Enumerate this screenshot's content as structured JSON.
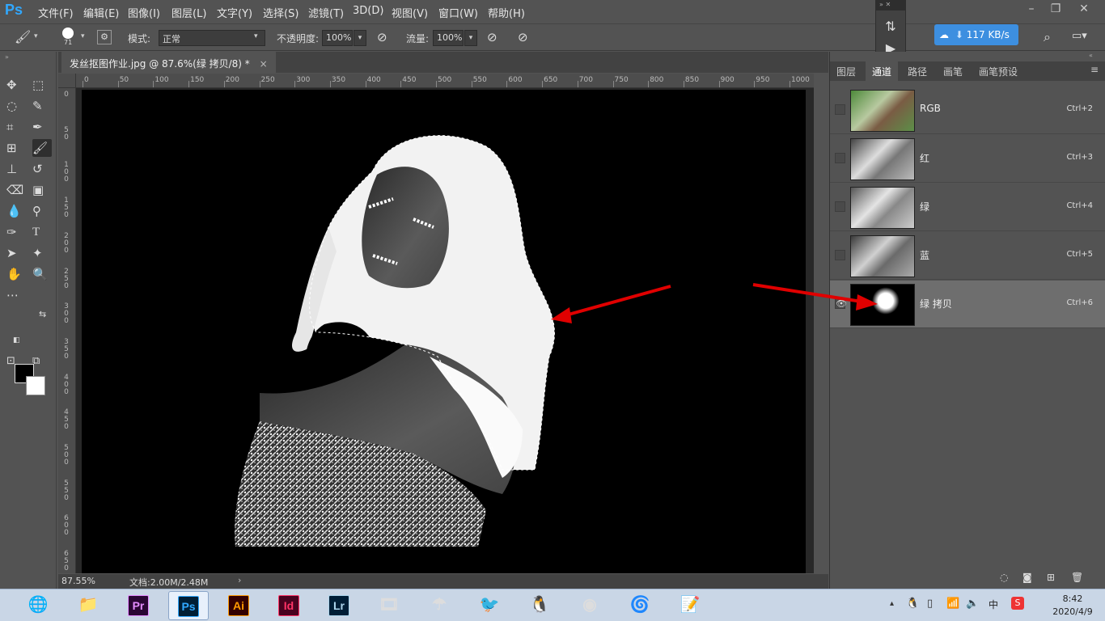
{
  "app": {
    "logo": "Ps"
  },
  "menu": [
    {
      "label": "文件(F)"
    },
    {
      "label": "编辑(E)"
    },
    {
      "label": "图像(I)"
    },
    {
      "label": "图层(L)"
    },
    {
      "label": "文字(Y)"
    },
    {
      "label": "选择(S)"
    },
    {
      "label": "滤镜(T)"
    },
    {
      "label": "3D(D)"
    },
    {
      "label": "视图(V)"
    },
    {
      "label": "窗口(W)"
    },
    {
      "label": "帮助(H)"
    }
  ],
  "options": {
    "brush_size": "71",
    "mode_label": "模式:",
    "mode_value": "正常",
    "opacity_label": "不透明度:",
    "opacity_value": "100%",
    "flow_label": "流量:",
    "flow_value": "100%"
  },
  "netspeed": {
    "text": "117 KB/s"
  },
  "document": {
    "tab_title": "发丝抠图作业.jpg @ 87.6%(绿 拷贝/8) *",
    "close": "×",
    "zoom": "87.55%",
    "doc_info": "文档:2.00M/2.48M"
  },
  "ruler": {
    "h_ticks": [
      "0",
      "50",
      "100",
      "150",
      "200",
      "250",
      "300",
      "350",
      "400",
      "450",
      "500",
      "550",
      "600",
      "650",
      "700",
      "750",
      "800",
      "850",
      "900",
      "950",
      "1000"
    ],
    "v_ticks": [
      "0",
      "50",
      "100",
      "150",
      "200",
      "250",
      "300",
      "350",
      "400",
      "450",
      "500",
      "550",
      "600",
      "650"
    ]
  },
  "panel": {
    "tabs": [
      {
        "label": "图层"
      },
      {
        "label": "通道"
      },
      {
        "label": "路径"
      },
      {
        "label": "画笔"
      },
      {
        "label": "画笔预设"
      }
    ],
    "active_tab": "通道",
    "channels": [
      {
        "name": "RGB",
        "shortcut": "Ctrl+2",
        "visible": false
      },
      {
        "name": "红",
        "shortcut": "Ctrl+3",
        "visible": false
      },
      {
        "name": "绿",
        "shortcut": "Ctrl+4",
        "visible": false
      },
      {
        "name": "蓝",
        "shortcut": "Ctrl+5",
        "visible": false
      },
      {
        "name": "绿 拷贝",
        "shortcut": "Ctrl+6",
        "visible": true,
        "selected": true
      }
    ]
  },
  "taskbar": {
    "apps": [
      {
        "icon": "browser-icon"
      },
      {
        "icon": "file-explorer-icon"
      },
      {
        "icon": "premiere-icon",
        "label": "Pr",
        "color": "#e48cff",
        "bg": "#2a0634"
      },
      {
        "icon": "photoshop-icon",
        "label": "Ps",
        "color": "#31a8ff",
        "bg": "#001e36"
      },
      {
        "icon": "illustrator-icon",
        "label": "Ai",
        "color": "#ff9a00",
        "bg": "#330000"
      },
      {
        "icon": "indesign-icon",
        "label": "Id",
        "color": "#ff3366",
        "bg": "#49021f"
      },
      {
        "icon": "lightroom-icon",
        "label": "Lr",
        "color": "#add5ec",
        "bg": "#001e36"
      },
      {
        "icon": "video-editor-icon"
      },
      {
        "icon": "umbrella-app-icon"
      },
      {
        "icon": "bird-app-icon"
      },
      {
        "icon": "qq-icon"
      },
      {
        "icon": "chrome-icon"
      },
      {
        "icon": "swirl-app-icon"
      },
      {
        "icon": "notepad-icon"
      }
    ],
    "time": "8:42",
    "date": "2020/4/9"
  },
  "colors": {
    "accent": "#31a8ff",
    "arrow": "#e00000"
  }
}
